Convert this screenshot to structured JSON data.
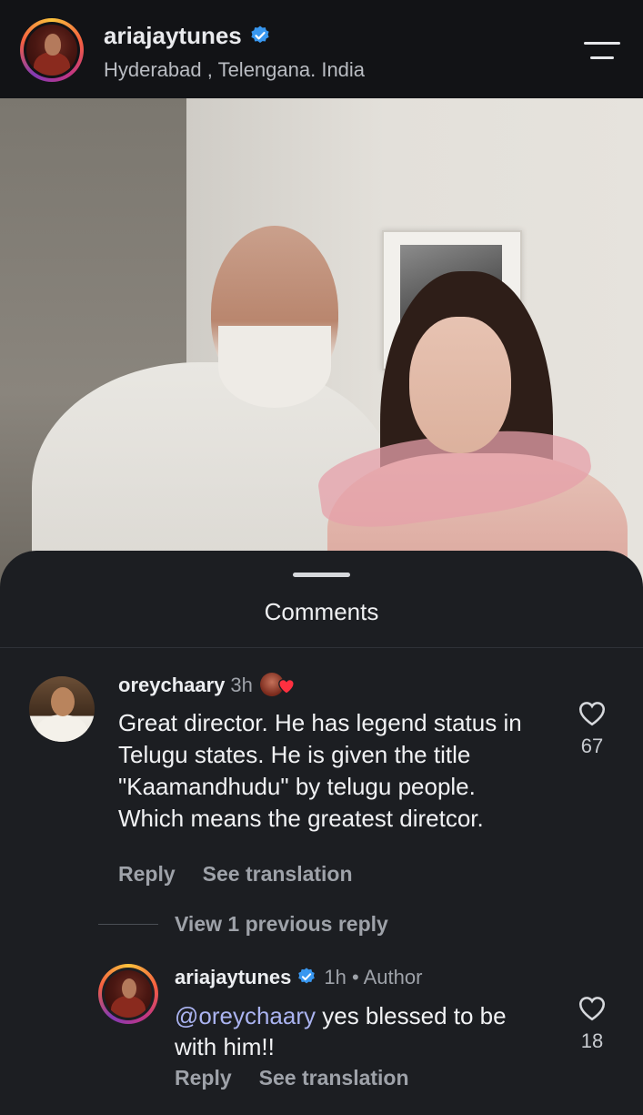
{
  "header": {
    "username": "ariajaytunes",
    "location": "Hyderabad , Telengana. India",
    "avatar_icon": "profile-photo",
    "verified_icon": "verified-badge-icon",
    "menu_icon": "hamburger-menu-icon",
    "colors": {
      "verified": "#3897f0",
      "background": "#121316"
    }
  },
  "comments_sheet": {
    "title": "Comments",
    "comments": [
      {
        "username": "oreychaary",
        "time": "3h",
        "text": "Great director. He has legend status in Telugu states. He is given the title \"Kaamandhudu\" by telugu people. Which means the greatest diretcor.",
        "reply_label": "Reply",
        "translate_label": "See translation",
        "likes": "67",
        "creator_liked_icon": "creator-heart-icon"
      }
    ],
    "view_previous": "View 1 previous reply",
    "reply": {
      "username": "ariajaytunes",
      "time": "1h",
      "separator": "•",
      "author_label": "Author",
      "mention": "@oreychaary",
      "text": " yes blessed to be with him!!",
      "reply_label": "Reply",
      "translate_label": "See translation",
      "likes": "18"
    }
  }
}
